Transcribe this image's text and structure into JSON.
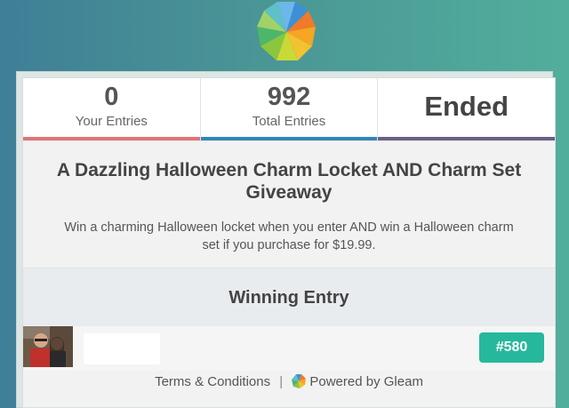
{
  "stats": {
    "your_entries_value": "0",
    "your_entries_label": "Your Entries",
    "total_entries_value": "992",
    "total_entries_label": "Total Entries",
    "status": "Ended"
  },
  "colors": {
    "bar_left": "#e07474",
    "bar_middle": "#2f86b8",
    "bar_right": "#6b5f86",
    "badge": "#26b89c"
  },
  "giveaway": {
    "title": "A Dazzling Halloween Charm Locket AND Charm Set Giveaway",
    "description": "Win a charming Halloween locket when you enter AND win a Halloween charm set if you purchase for $19.99."
  },
  "winning": {
    "heading": "Winning Entry",
    "entry_number": "#580"
  },
  "footer": {
    "terms": "Terms & Conditions",
    "separator": "|",
    "powered": "Powered by Gleam"
  }
}
